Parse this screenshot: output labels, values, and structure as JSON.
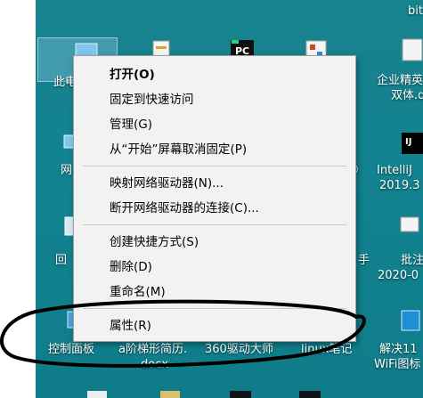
{
  "context_menu": {
    "items": [
      {
        "label": "打开(O)"
      },
      {
        "label": "固定到快速访问"
      },
      {
        "label": "管理(G)"
      },
      {
        "label": "从“开始”屏幕取消固定(P)"
      },
      {
        "label": "映射网络驱动器(N)..."
      },
      {
        "label": "断开网络驱动器的连接(C)..."
      },
      {
        "label": "创建快捷方式(S)"
      },
      {
        "label": "删除(D)"
      },
      {
        "label": "重命名(M)"
      },
      {
        "label": "属性(R)"
      }
    ]
  },
  "desktop": {
    "icons": [
      {
        "label": "此电"
      },
      {
        "label": "网"
      },
      {
        "label": "回"
      },
      {
        "label": "控制面板"
      },
      {
        "label": "a阶梯形简历."
      },
      {
        "label": "docx"
      },
      {
        "label": "360驱动大师"
      },
      {
        "label": "linux笔记"
      },
      {
        "label": "解决11"
      },
      {
        "label": "WiFi图标"
      },
      {
        "label": "企业精英"
      },
      {
        "label": "双体.d"
      },
      {
        "label": "IntelliJ"
      },
      {
        "label": "2019.3"
      },
      {
        "label": "批注"
      },
      {
        "label": "2020-0"
      },
      {
        "label": "bit"
      },
      {
        "label": "》"
      },
      {
        "label": "手"
      }
    ],
    "background_color": "#128390"
  },
  "annotation": {
    "color": "#000000"
  }
}
